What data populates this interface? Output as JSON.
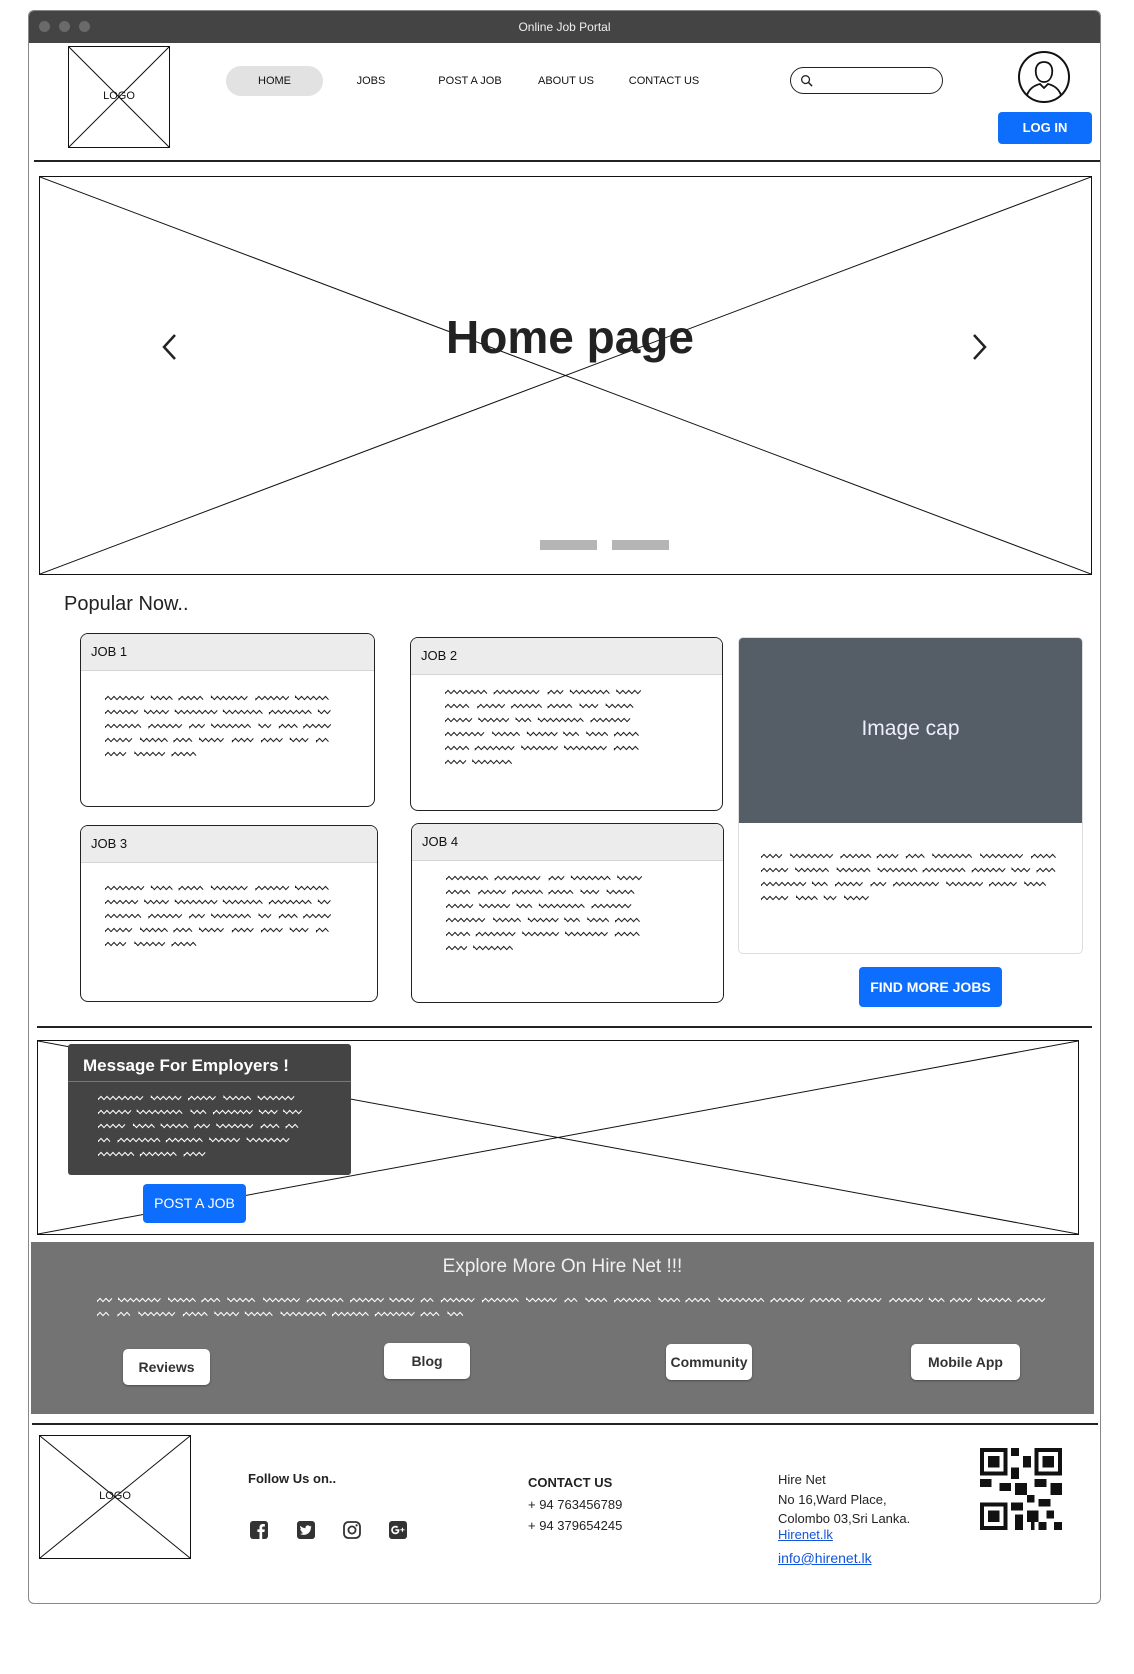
{
  "window": {
    "title": "Online Job Portal"
  },
  "header": {
    "logo_label": "LOGO",
    "nav": [
      {
        "label": "HOME",
        "active": true
      },
      {
        "label": "JOBS"
      },
      {
        "label": "POST A JOB"
      },
      {
        "label": "ABOUT US"
      },
      {
        "label": "CONTACT US"
      }
    ],
    "search": {
      "placeholder": ""
    },
    "login_label": "LOG IN"
  },
  "hero": {
    "title": "Home page",
    "prev_icon": "chevron-left-icon",
    "next_icon": "chevron-right-icon",
    "slides": 2
  },
  "popular": {
    "heading": "Popular Now..",
    "jobs": [
      {
        "title": "JOB 1"
      },
      {
        "title": "JOB 2"
      },
      {
        "title": "JOB 3"
      },
      {
        "title": "JOB 4"
      }
    ],
    "image_card": {
      "cap": "Image cap"
    },
    "find_more_label": "FIND MORE JOBS"
  },
  "employers": {
    "title": "Message For Employers !",
    "button_label": "POST A JOB"
  },
  "explore": {
    "title": "Explore More On Hire Net !!!",
    "buttons": [
      "Reviews",
      "Blog",
      "Community",
      "Mobile App"
    ]
  },
  "footer": {
    "logo_label": "LOGO",
    "follow_label": "Follow Us on..",
    "social_icons": [
      "facebook-icon",
      "twitter-icon",
      "instagram-icon",
      "google-plus-icon"
    ],
    "contact": {
      "heading": "CONTACT US",
      "phones": [
        "+ 94 763456789",
        "+ 94 379654245"
      ]
    },
    "address": {
      "lines": [
        "Hire Net",
        "No 16,Ward Place,",
        "Colombo 03,Sri Lanka."
      ],
      "website": "Hirenet.lk",
      "email": "info@hirenet.lk"
    }
  },
  "colors": {
    "accent": "#0d6efd",
    "titlebar": "#444444",
    "explore_band": "#737373",
    "image_cap": "#555d66",
    "employer_panel": "#444444"
  }
}
